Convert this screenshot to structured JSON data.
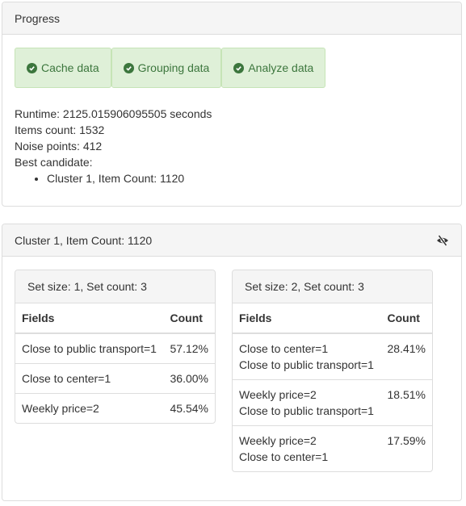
{
  "progress": {
    "title": "Progress",
    "steps": [
      {
        "label": "Cache data",
        "icon": "check-circle-icon"
      },
      {
        "label": "Grouping data",
        "icon": "check-circle-icon"
      },
      {
        "label": "Analyze data",
        "icon": "check-circle-icon"
      }
    ],
    "runtime": "Runtime: 2125.015906095505 seconds",
    "items_count": "Items count: 1532",
    "noise_points": "Noise points: 412",
    "best_candidate_label": "Best candidate:",
    "best_candidates": [
      "Cluster 1, Item Count: 1120"
    ]
  },
  "cluster": {
    "title": "Cluster 1, Item Count: 1120",
    "toggle_icon": "eye-slash-icon",
    "sets": [
      {
        "title": "Set size: 1, Set count: 3",
        "columns": [
          "Fields",
          "Count"
        ],
        "rows": [
          {
            "fields": [
              "Close to public transport=1"
            ],
            "count": "57.12%"
          },
          {
            "fields": [
              "Close to center=1"
            ],
            "count": "36.00%"
          },
          {
            "fields": [
              "Weekly price=2"
            ],
            "count": "45.54%"
          }
        ]
      },
      {
        "title": "Set size: 2, Set count: 3",
        "columns": [
          "Fields",
          "Count"
        ],
        "rows": [
          {
            "fields": [
              "Close to center=1",
              "Close to public transport=1"
            ],
            "count": "28.41%"
          },
          {
            "fields": [
              "Weekly price=2",
              "Close to public transport=1"
            ],
            "count": "18.51%"
          },
          {
            "fields": [
              "Weekly price=2",
              "Close to center=1"
            ],
            "count": "17.59%"
          }
        ]
      }
    ]
  },
  "colors": {
    "success_bg": "#dff0d8",
    "success_text": "#3c763d",
    "heading_bg": "#f5f5f5",
    "border": "#dddddd"
  }
}
